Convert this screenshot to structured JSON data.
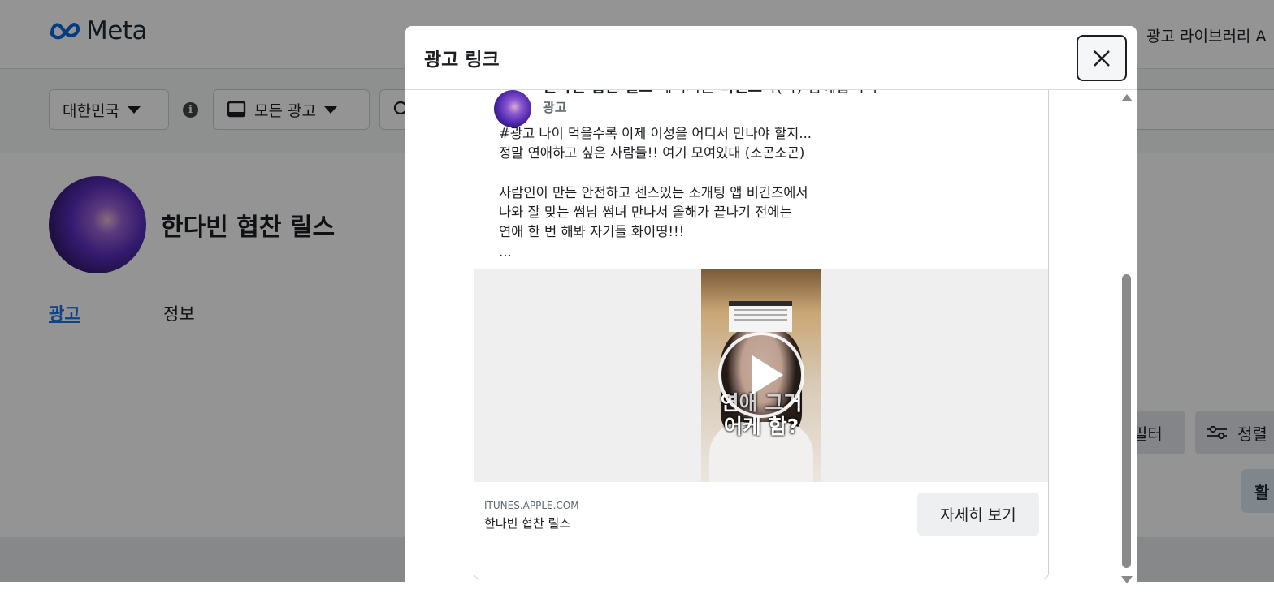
{
  "header": {
    "brand": "Meta",
    "top_link": "광고 라이브러리 A"
  },
  "filters": {
    "country": "대한민국",
    "ad_type": "모든 광고",
    "info_icon": "info-icon",
    "search_icon": "search-icon"
  },
  "profile": {
    "name": "한다빈 협찬 릴스",
    "tabs": [
      {
        "label": "광고",
        "active": true
      },
      {
        "label": "정보",
        "active": false
      }
    ]
  },
  "side_buttons": {
    "filter_label": "필터",
    "sort_label": "정렬",
    "active_label": "활"
  },
  "modal": {
    "title": "광고 링크",
    "close_icon": "close-icon",
    "card": {
      "page_name": "한다빈 협찬 릴스",
      "heading_middle": " 페이지는 ",
      "partner": "비긴즈",
      "heading_end": "와(과) 함께합니다",
      "sublabel": "광고",
      "text_lines": [
        "#광고 나이 먹을수록 이제 이성을 어디서 만나야 할지...",
        "정말 연애하고 싶은 사람들!! 여기 모여있대 (소곤소곤)",
        "",
        "사람인이 만든 안전하고 센스있는 소개팅 앱 비긴즈에서",
        "나와 잘 맞는 썸남 썸녀 만나서 올해가 끝나기 전에는",
        "연애 한 번 해봐 자기들 화이띵!!!",
        "..."
      ],
      "video_caption": [
        "연애 그거",
        "어케 함?"
      ],
      "play_icon": "play-icon",
      "link_domain": "ITUNES.APPLE.COM",
      "link_title": "한다빈 협찬 릴스",
      "cta_label": "자세히 보기"
    }
  },
  "colors": {
    "link_blue": "#1b74e4",
    "overlay": "rgba(0,0,0,0.42)",
    "meta_blue": "#0668e1"
  }
}
